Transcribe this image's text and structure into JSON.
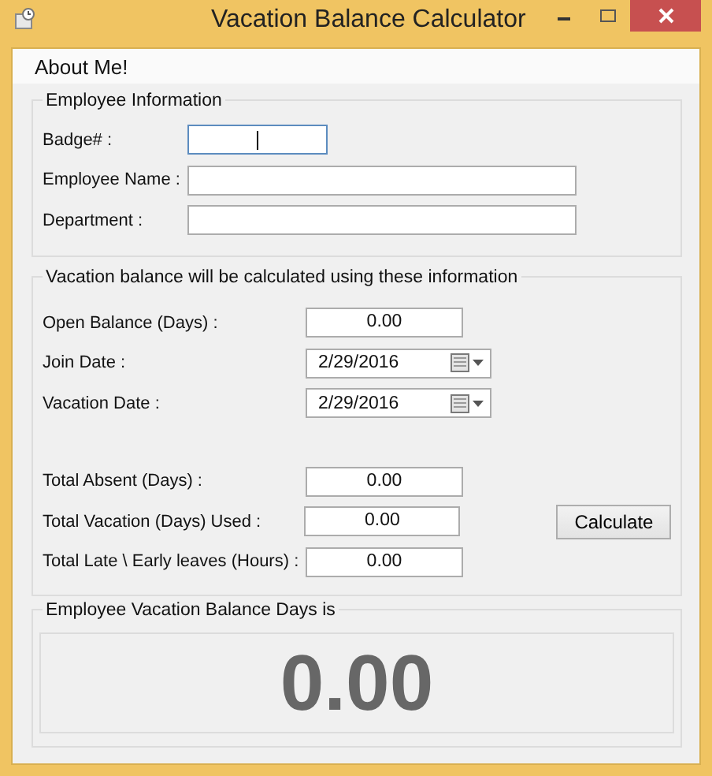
{
  "window": {
    "title": "Vacation Balance Calculator"
  },
  "menu": [
    {
      "label": "About Me!"
    }
  ],
  "employee_info": {
    "title": "Employee Information",
    "fields": [
      {
        "label": "Badge# :",
        "focused": true
      },
      {
        "label": "Employee Name :",
        "focused": false
      },
      {
        "label": "Department :",
        "focused": false
      }
    ]
  },
  "vacation": {
    "title": "Vacation balance will be calculated using these information",
    "inputs": [
      {
        "kind": "number",
        "label": "Open Balance (Days) :",
        "value": "0.00"
      },
      {
        "kind": "date",
        "label": "Join Date :",
        "value": "2/29/2016"
      },
      {
        "kind": "date",
        "label": "Vacation Date :",
        "value": "2/29/2016"
      }
    ],
    "totals": [
      {
        "label": "Total Absent (Days) :",
        "value": "0.00"
      },
      {
        "label": "Total Vacation (Days) Used :",
        "value": "0.00"
      },
      {
        "label": "Total Late \\ Early leaves (Hours) :",
        "value": "0.00"
      }
    ],
    "button": "Calculate"
  },
  "result": {
    "title": "Employee Vacation Balance Days is",
    "value": "0.00"
  }
}
